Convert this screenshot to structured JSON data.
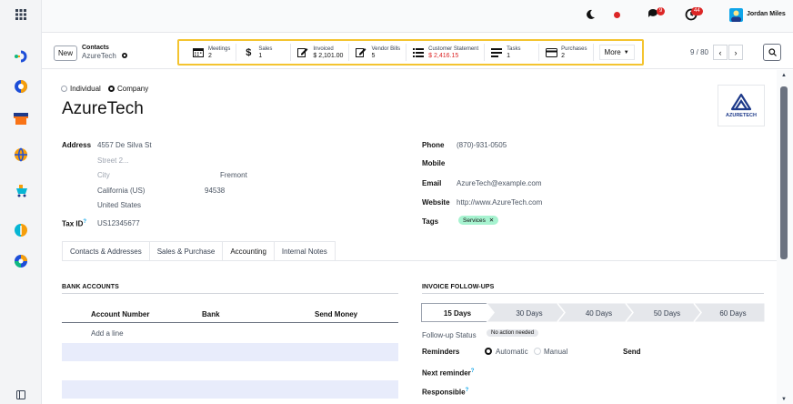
{
  "rail": {
    "apps_icon": "grid-icon",
    "items": [
      "discuss-app-icon",
      "crm-app-icon",
      "point-of-sale-icon",
      "website-app-icon",
      "ecommerce-icon",
      "studio-app-icon",
      "inventory-app-icon"
    ],
    "bottom_icon": "sidebar-toggle-icon"
  },
  "topbar": {
    "user_name": "Jordan Miles",
    "messages_count": "9",
    "activity_count": "44",
    "accent_red": "#dc2626"
  },
  "control_panel": {
    "new_label": "New",
    "breadcrumb_title": "Contacts",
    "breadcrumb_record": "AzureTech",
    "pager_text": "9 / 80"
  },
  "smart_buttons": [
    {
      "icon": "calendar-icon",
      "label": "Meetings",
      "value": "2"
    },
    {
      "icon": "dollar-icon",
      "label": "Sales",
      "value": "1"
    },
    {
      "icon": "invoice-icon",
      "label": "Invoiced",
      "value": "$ 2,101.00"
    },
    {
      "icon": "bill-icon",
      "label": "Vendor Bills",
      "value": "5"
    },
    {
      "icon": "statement-icon",
      "label": "Customer Statement",
      "value": "$ 2,416.15",
      "value_color": "#dc2626"
    },
    {
      "icon": "tasks-icon",
      "label": "Tasks",
      "value": "1"
    },
    {
      "icon": "purchase-icon",
      "label": "Purchases",
      "value": "2"
    }
  ],
  "more_label": "More",
  "highlight_color": "#f4c430",
  "form": {
    "type_individual": "Individual",
    "type_company": "Company",
    "name": "AzureTech",
    "logo_text": "AZURETECH",
    "address_label": "Address",
    "street": "4557 De Silva St",
    "street2_ph": "Street 2...",
    "city_ph": "City",
    "city": "Fremont",
    "state": "California (US)",
    "zip": "94538",
    "country": "United States",
    "taxid_label": "Tax ID",
    "taxid": "US12345677",
    "phone_label": "Phone",
    "phone": "(870)-931-0505",
    "mobile_label": "Mobile",
    "email_label": "Email",
    "email": "AzureTech@example.com",
    "website_label": "Website",
    "website": "http://www.AzureTech.com",
    "tags_label": "Tags",
    "tag": "Services"
  },
  "tabs": [
    "Contacts & Addresses",
    "Sales & Purchase",
    "Accounting",
    "Internal Notes"
  ],
  "bank": {
    "title": "BANK ACCOUNTS",
    "col_account": "Account Number",
    "col_bank": "Bank",
    "col_send": "Send Money",
    "add_line": "Add a line"
  },
  "followup": {
    "title": "INVOICE FOLLOW-UPS",
    "stages": [
      "15 Days",
      "30 Days",
      "40 Days",
      "50 Days",
      "60 Days"
    ],
    "status_label": "Follow-up Status",
    "status_value": "No action needed",
    "reminders_label": "Reminders",
    "opt_auto": "Automatic",
    "opt_manual": "Manual",
    "send_label": "Send",
    "next_label": "Next reminder",
    "resp_label": "Responsible"
  }
}
